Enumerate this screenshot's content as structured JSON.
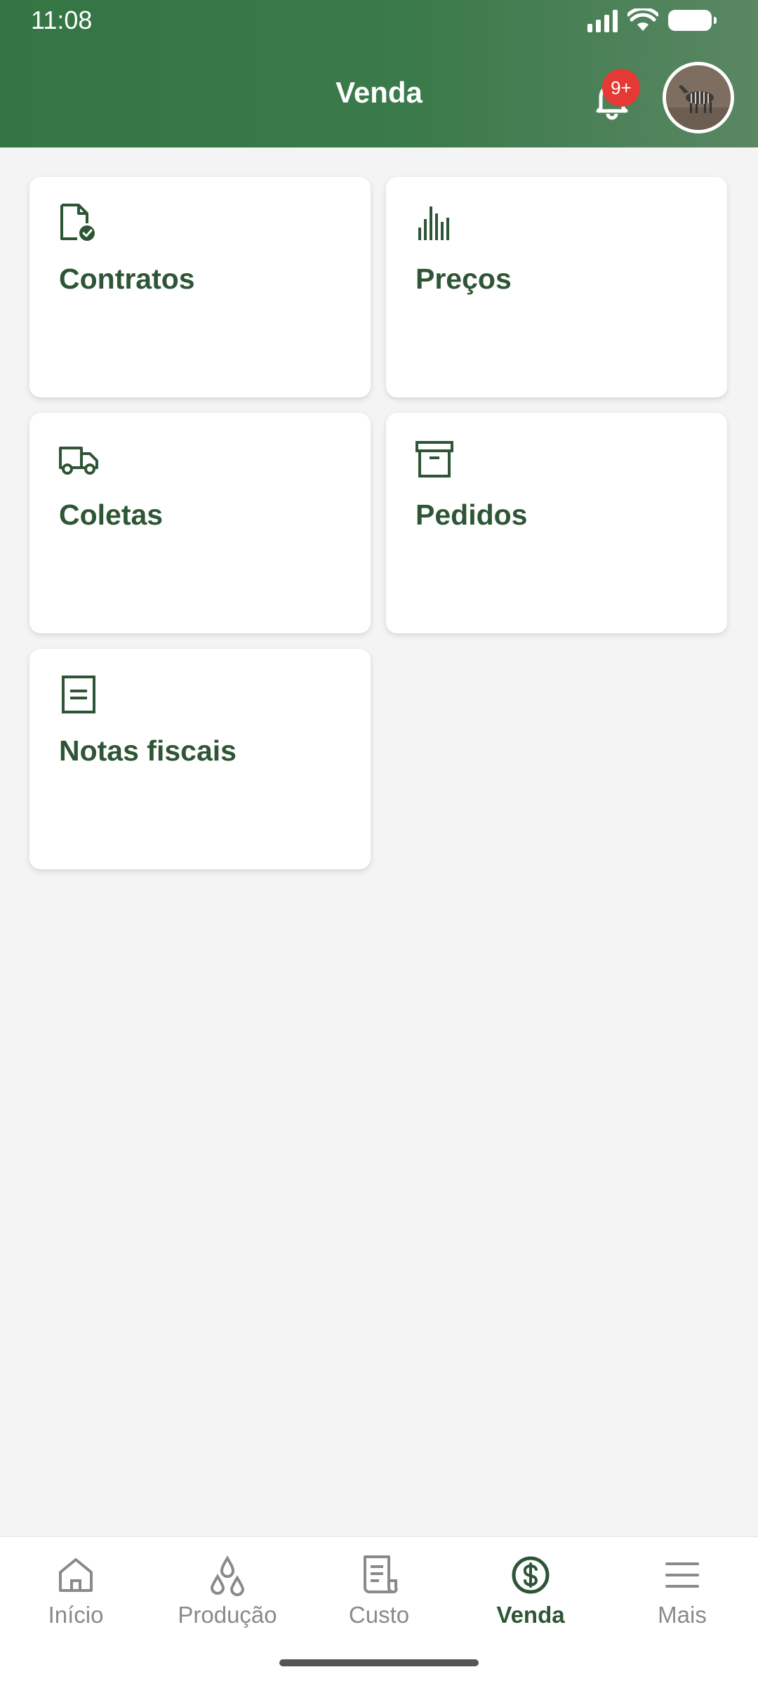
{
  "status_bar": {
    "time": "11:08"
  },
  "header": {
    "title": "Venda",
    "notification_badge": "9+"
  },
  "cards": [
    {
      "label": "Contratos",
      "icon": "contract-document-icon"
    },
    {
      "label": "Preços",
      "icon": "bar-chart-icon"
    },
    {
      "label": "Coletas",
      "icon": "truck-icon"
    },
    {
      "label": "Pedidos",
      "icon": "archive-box-icon"
    },
    {
      "label": "Notas fiscais",
      "icon": "invoice-document-icon"
    }
  ],
  "bottom_nav": {
    "items": [
      {
        "label": "Início",
        "icon": "home-icon",
        "active": false
      },
      {
        "label": "Produção",
        "icon": "drops-icon",
        "active": false
      },
      {
        "label": "Custo",
        "icon": "receipt-icon",
        "active": false
      },
      {
        "label": "Venda",
        "icon": "dollar-circle-icon",
        "active": true
      },
      {
        "label": "Mais",
        "icon": "menu-icon",
        "active": false
      }
    ]
  },
  "colors": {
    "header_green": "#357544",
    "accent_dark_green": "#2e5535",
    "badge_red": "#e53935",
    "background": "#f4f4f4"
  }
}
